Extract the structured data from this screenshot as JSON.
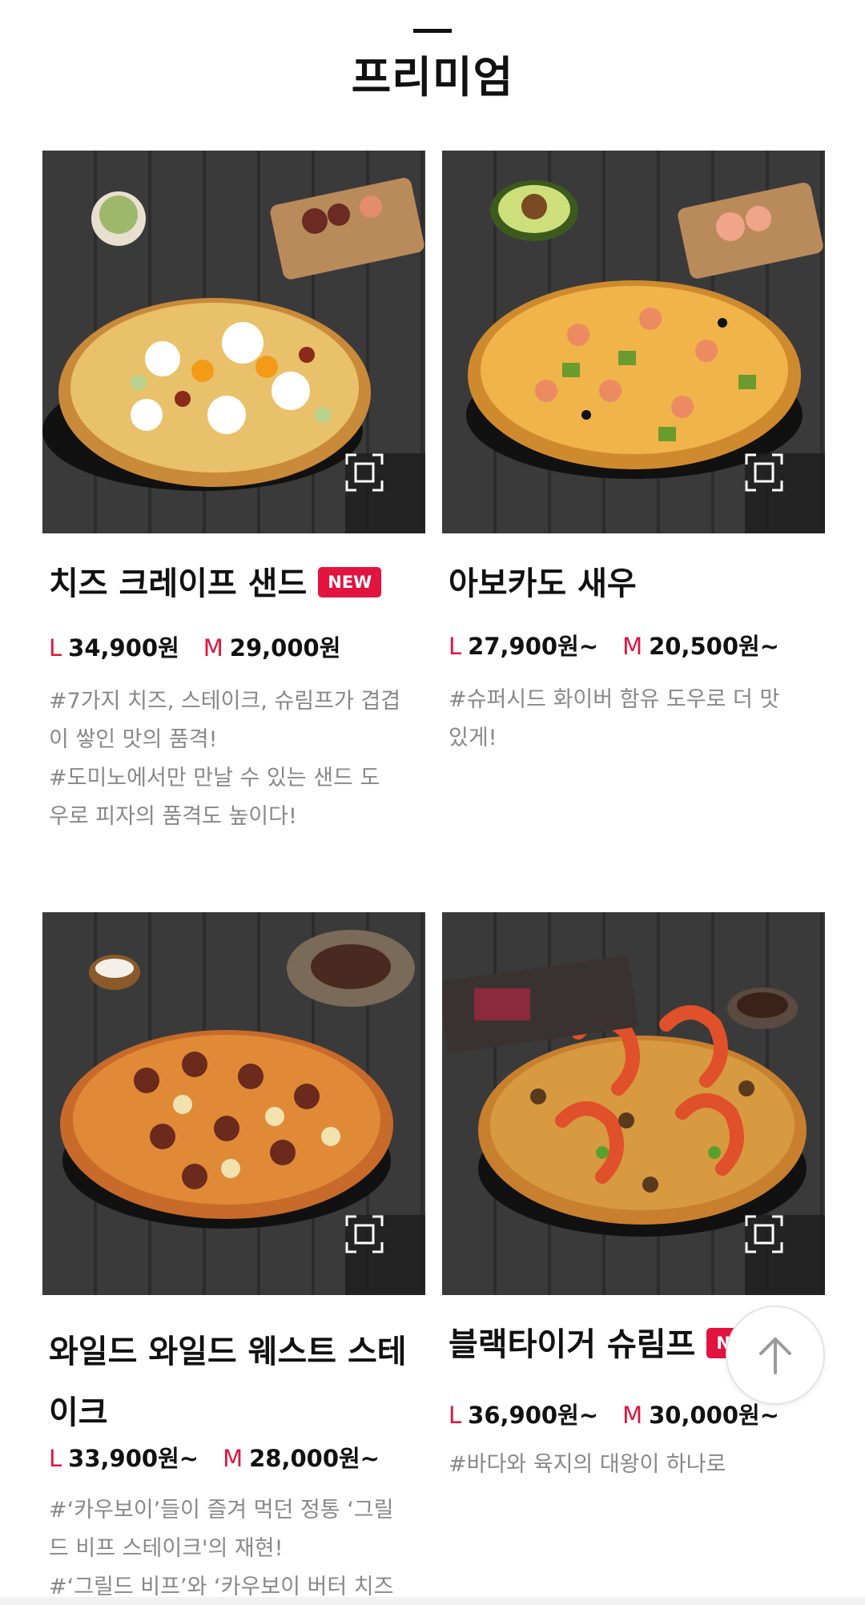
{
  "section": {
    "title": "프리미엄"
  },
  "products": [
    {
      "name": "치즈 크레이프 샌드",
      "badge": "NEW",
      "price_l_label": "L",
      "price_l": "34,900원",
      "price_m_label": "M",
      "price_m": "29,000원",
      "desc": [
        "#7가지 치즈, 스테이크, 슈림프가 겹겹",
        "이 쌓인 맛의 품격!",
        "#도미노에서만 만날 수 있는 샌드 도",
        "우로 피자의 품격도 높이다!"
      ]
    },
    {
      "name": "아보카도 새우",
      "badge": "",
      "price_l_label": "L",
      "price_l": "27,900원~",
      "price_m_label": "M",
      "price_m": "20,500원~",
      "desc": [
        "#슈퍼시드 화이버 함유 도우로 더 맛",
        "있게!"
      ]
    },
    {
      "name_line1": "와일드 와일드 웨스트 스테",
      "name_line2": "이크",
      "badge": "",
      "price_l_label": "L",
      "price_l": "33,900원~",
      "price_m_label": "M",
      "price_m": "28,000원~",
      "desc": [
        "#‘카우보이’들이 즐겨 먹던 정통 ‘그릴",
        "드 비프 스테이크'의 재현!",
        "#‘그릴드 비프’와 ‘카우보이 버터 치즈"
      ]
    },
    {
      "name": "블랙타이거 슈림프",
      "badge": "NEW",
      "price_l_label": "L",
      "price_l": "36,900원~",
      "price_m_label": "M",
      "price_m": "30,000원~",
      "desc": [
        "#바다와 육지의 대왕이 하나로"
      ]
    }
  ],
  "icons": {
    "zoom": "expand-icon",
    "scroll_top": "arrow-up-icon"
  },
  "colors": {
    "accent": "#e2143f",
    "text": "#111111",
    "muted": "#888888"
  }
}
